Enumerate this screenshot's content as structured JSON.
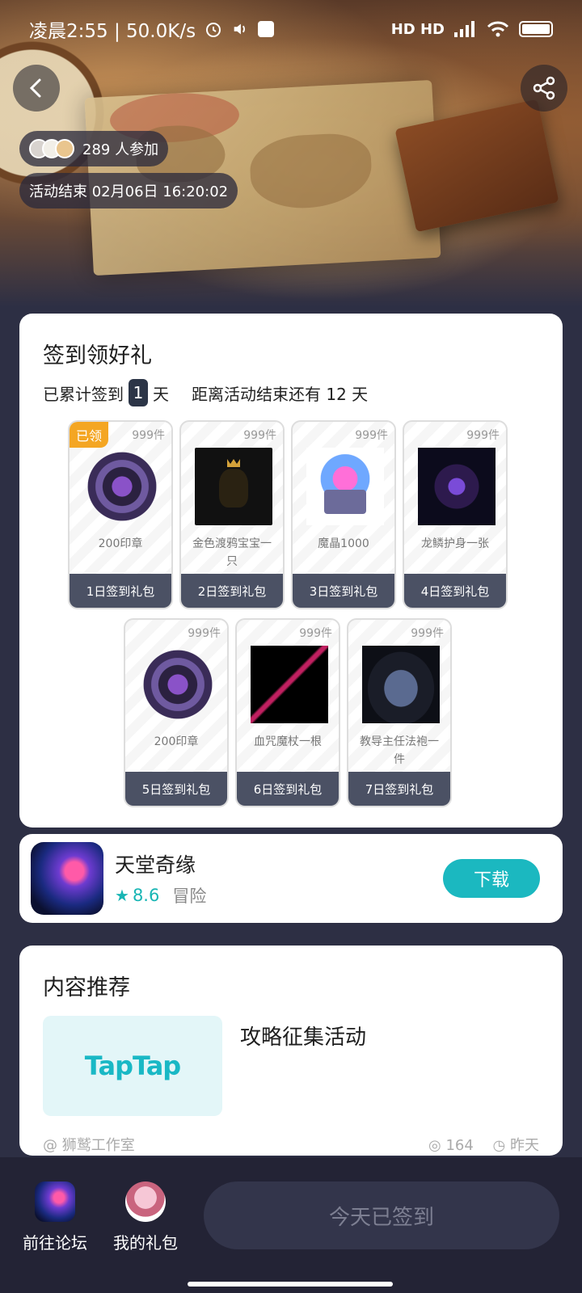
{
  "status_bar": {
    "time_speed": "凌晨2:55 | 50.0K/s",
    "network_labels": "HD HD",
    "alarm_icon": "alarm-icon",
    "volume_icon": "volume-icon",
    "wifi_icon": "wifi-icon",
    "battery_icon": "battery-icon"
  },
  "hero": {
    "participants_text": "289 人参加",
    "end_time_text": "活动结束 02月06日 16:20:02",
    "back_icon": "back-arrow-icon",
    "share_icon": "share-icon"
  },
  "checkin": {
    "title": "签到领好礼",
    "accumulated_prefix": "已累计签到",
    "accumulated_days": "1",
    "accumulated_suffix": "天",
    "remaining_text": "距离活动结束还有 12 天",
    "claimed_badge": "已领",
    "rewards": [
      {
        "stock": "999件",
        "name": "200印章",
        "label": "1日签到礼包"
      },
      {
        "stock": "999件",
        "name": "金色渡鸦宝宝一只",
        "label": "2日签到礼包"
      },
      {
        "stock": "999件",
        "name": "魔晶1000",
        "label": "3日签到礼包"
      },
      {
        "stock": "999件",
        "name": "龙鳞护身一张",
        "label": "4日签到礼包"
      },
      {
        "stock": "999件",
        "name": "200印章",
        "label": "5日签到礼包"
      },
      {
        "stock": "999件",
        "name": "血咒魔杖一根",
        "label": "6日签到礼包"
      },
      {
        "stock": "999件",
        "name": "教导主任法袍一件",
        "label": "7日签到礼包"
      }
    ]
  },
  "app": {
    "name": "天堂奇缘",
    "rating": "8.6",
    "genre": "冒险",
    "download_label": "下载"
  },
  "content": {
    "title": "内容推荐",
    "post_thumb_text": "TapTap",
    "post_title": "攻略征集活动",
    "post_author": "@ 狮鹫工作室",
    "post_views": "164",
    "post_time": "昨天"
  },
  "bottom_bar": {
    "forum_label": "前往论坛",
    "gift_label": "我的礼包",
    "checked_label": "今天已签到"
  },
  "colors": {
    "accent": "#1bb8c0",
    "claimed": "#f4a623",
    "dark": "#232335"
  }
}
